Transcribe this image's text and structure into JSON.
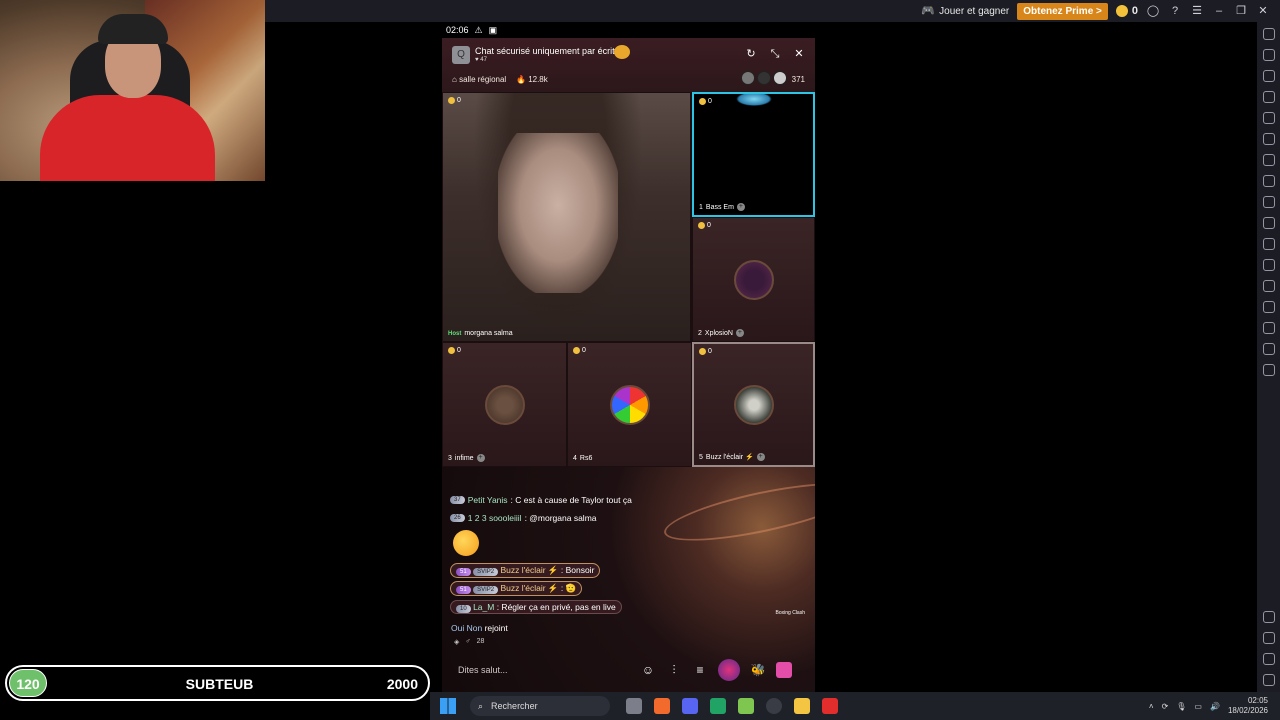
{
  "topbar": {
    "play_and_win": "Jouer et gagner",
    "get_prime": "Obtenez Prime >",
    "coins": "0",
    "icons": [
      "account-icon",
      "help-icon",
      "menu-icon",
      "minimize-icon",
      "restore-icon",
      "close-icon"
    ]
  },
  "status_bar": {
    "time": "02:06"
  },
  "room": {
    "title": "Chat sécurisé uniquement par écrit",
    "likes": "47",
    "region": "salle régional",
    "popularity": "12.8k",
    "viewers": "371"
  },
  "seats": [
    {
      "tag": "Host",
      "name": "morgana salma",
      "coins": "0"
    },
    {
      "index": "1",
      "name": "Bass Em",
      "coins": "0"
    },
    {
      "index": "2",
      "name": "XplosioN",
      "coins": "0"
    },
    {
      "index": "3",
      "name": "infime",
      "coins": "0"
    },
    {
      "index": "4",
      "name": "Rs6",
      "coins": "0"
    },
    {
      "index": "5",
      "name": "Buzz l'éclair ⚡",
      "coins": "0"
    }
  ],
  "chat": [
    {
      "level": "37",
      "user": "Petit Yanis",
      "text": ": C est à cause de Taylor tout ça"
    },
    {
      "level": "26",
      "user": "1 2 3 soooleiiil",
      "text": ": @morgana salma"
    },
    {
      "level": "51",
      "badge": "SVIP2",
      "user": "Buzz l'éclair ⚡",
      "text": ": Bonsoir"
    },
    {
      "level": "51",
      "badge": "SVIP2",
      "user": "Buzz l'éclair ⚡",
      "text": ": 🫡"
    },
    {
      "level": "10",
      "user": "La_M",
      "text": ": Régler ça en privé, pas en live"
    }
  ],
  "join": {
    "user": "Oui Non",
    "text": "rejoint",
    "count": "28"
  },
  "boxing": "Boxing Clash",
  "input": {
    "placeholder": "Dites salut..."
  },
  "overlay": {
    "level": "120",
    "label": "SUBTEUB",
    "goal": "2000"
  },
  "taskbar": {
    "search": "Rechercher",
    "time": "02:05",
    "date": "18/02/2026"
  }
}
